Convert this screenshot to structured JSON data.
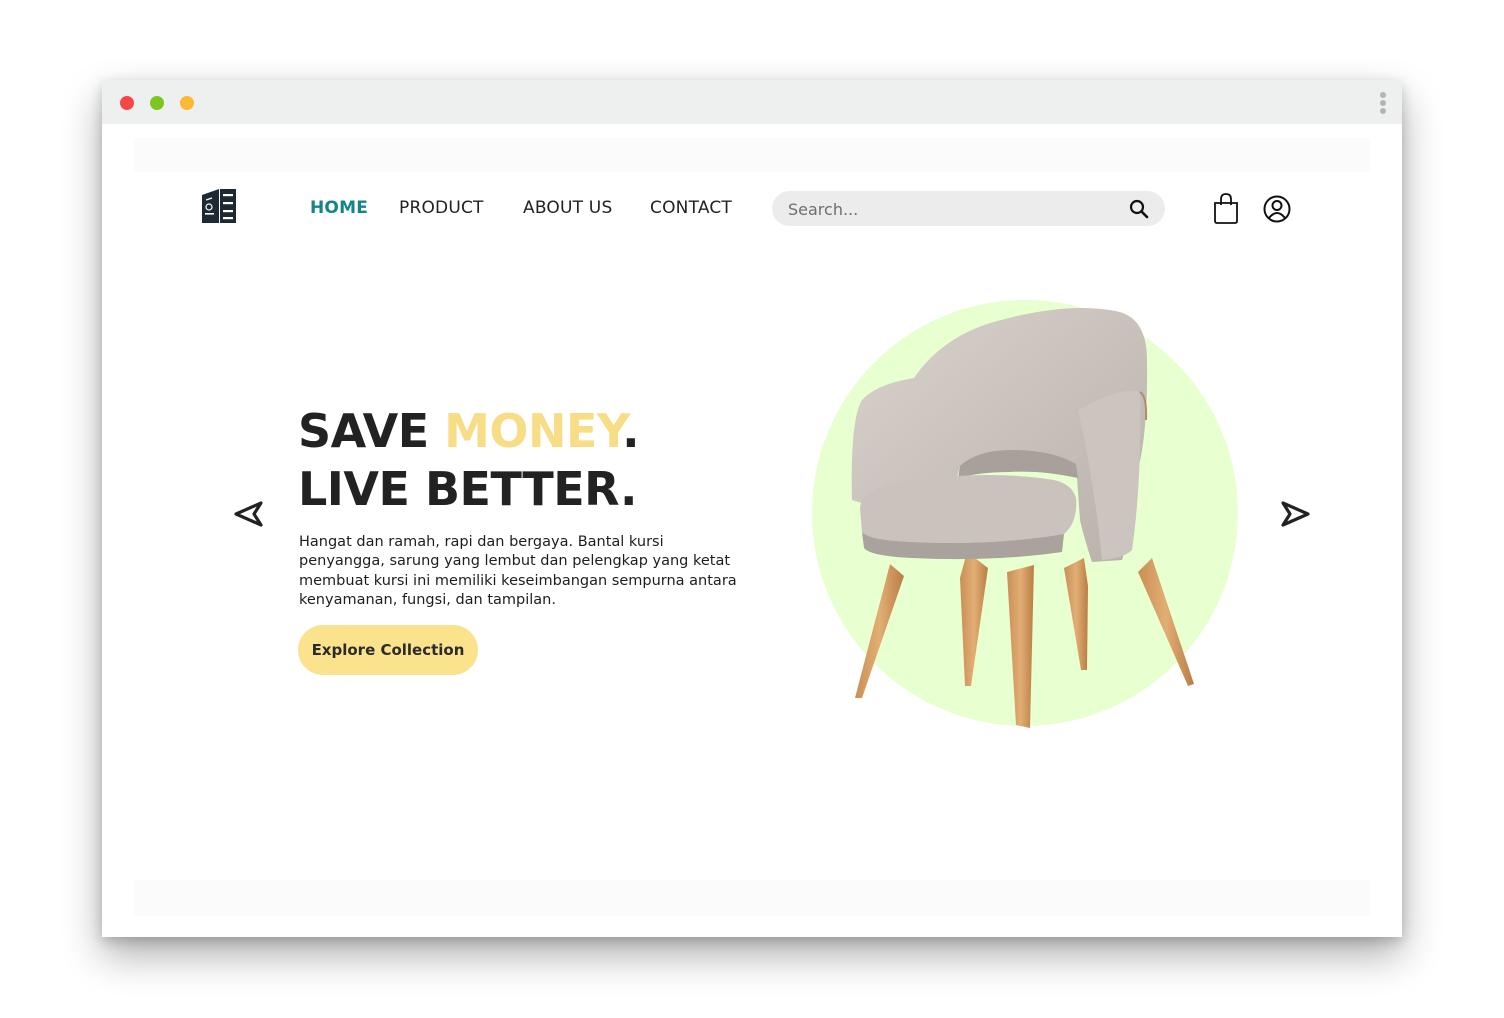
{
  "browser": {
    "window_controls": [
      "close",
      "minimize",
      "maximize"
    ],
    "menu_icon": "kebab-menu-icon"
  },
  "header": {
    "logo_icon": "bookshelf-logo-icon",
    "nav": [
      {
        "label": "HOME",
        "active": true
      },
      {
        "label": "PRODUCT",
        "active": false
      },
      {
        "label": "ABOUT US",
        "active": false
      },
      {
        "label": "CONTACT",
        "active": false
      }
    ],
    "search": {
      "placeholder": "Search...",
      "value": "",
      "icon": "search-icon"
    },
    "cart_icon": "shopping-bag-icon",
    "account_icon": "user-circle-icon"
  },
  "hero": {
    "headline": {
      "part1": "SAVE ",
      "accent": "MONEY",
      "part2": ".",
      "line2": "LIVE BETTER."
    },
    "description": "Hangat dan ramah, rapi dan bergaya. Bantal kursi penyangga, sarung yang lembut dan pelengkap yang ketat membuat kursi ini memiliki keseimbangan sempurna antara kenyamanan, fungsi, dan tampilan.",
    "cta_label": "Explore Collection",
    "prev_icon": "arrow-left-icon",
    "next_icon": "arrow-right-icon",
    "image": "armchair-product-image"
  },
  "colors": {
    "accent_teal": "#14868a",
    "accent_yellow": "#f8dd87",
    "button_yellow": "#fbe38e",
    "circle_green": "#e8ffcf",
    "text_dark": "#222222"
  }
}
